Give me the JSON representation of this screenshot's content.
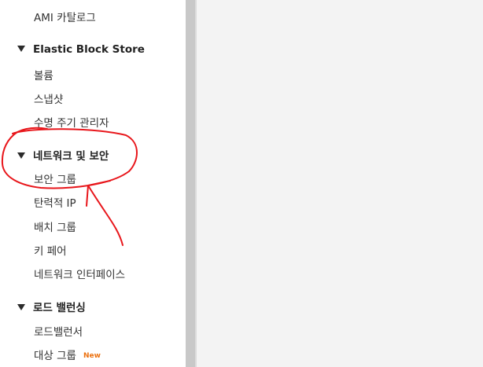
{
  "sidebar": {
    "top_item": {
      "label": "AMI 카탈로그"
    },
    "groups": [
      {
        "title": "Elastic Block Store",
        "items": [
          {
            "label": "볼륨"
          },
          {
            "label": "스냅샷"
          },
          {
            "label": "수명 주기 관리자"
          }
        ]
      },
      {
        "title": "네트워크 및 보안",
        "items": [
          {
            "label": "보안 그룹"
          },
          {
            "label": "탄력적 IP"
          },
          {
            "label": "배치 그룹"
          },
          {
            "label": "키 페어"
          },
          {
            "label": "네트워크 인터페이스"
          }
        ]
      },
      {
        "title": "로드 밸런싱",
        "items": [
          {
            "label": "로드밸런서"
          },
          {
            "label": "대상 그룹",
            "badge": "New"
          }
        ]
      }
    ]
  },
  "annotation": {
    "color": "#e8161b"
  },
  "colors": {
    "badge": "#ec7211",
    "content_background": "#f3f3f3",
    "scrollbar": "#c8c8c8"
  }
}
